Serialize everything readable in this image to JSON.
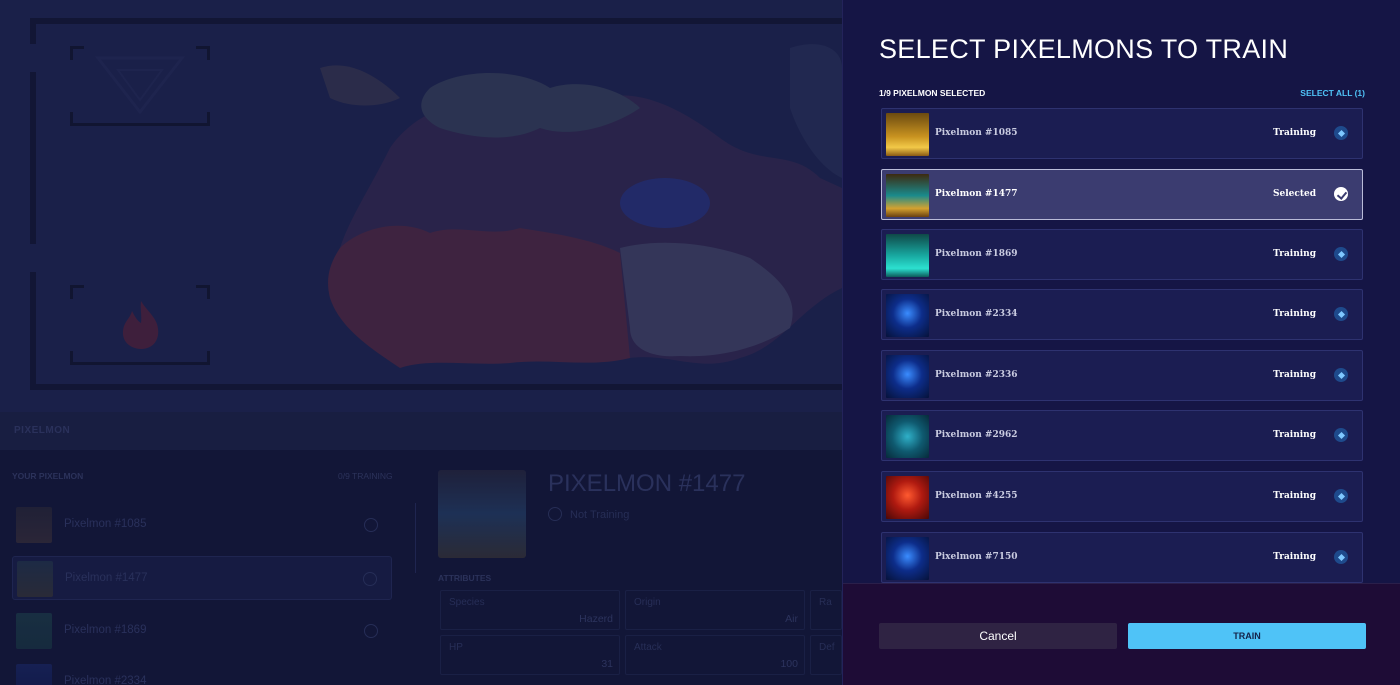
{
  "background": {
    "brand": "PIXELMON",
    "list_title": "YOUR PIXELMON",
    "list_count": "0/9 TRAINING",
    "list_items": [
      {
        "label": "Pixelmon #1085"
      },
      {
        "label": "Pixelmon #1477"
      },
      {
        "label": "Pixelmon #1869"
      },
      {
        "label": "Pixelmon #2334"
      }
    ],
    "detail": {
      "title": "PIXELMON #1477",
      "status": "Not Training",
      "attributes_title": "ATTRIBUTES",
      "attributes": [
        {
          "name": "Species",
          "value": "Hazerd"
        },
        {
          "name": "Origin",
          "value": "Air"
        },
        {
          "name": "Ra",
          "value": ""
        },
        {
          "name": "HP",
          "value": "31"
        },
        {
          "name": "Attack",
          "value": "100"
        },
        {
          "name": "Def",
          "value": ""
        }
      ]
    }
  },
  "modal": {
    "title": "SELECT PIXELMONS TO TRAIN",
    "selected_count": "1/9 PIXELMON SELECTED",
    "select_all": "SELECT ALL (1)",
    "pixelmons": [
      {
        "name": "Pixelmon #1085",
        "status": "Training",
        "icon": "plus-icon",
        "theme": "gold"
      },
      {
        "name": "Pixelmon #1477",
        "status": "Selected",
        "icon": "check-icon",
        "theme": "teal-gold"
      },
      {
        "name": "Pixelmon #1869",
        "status": "Training",
        "icon": "plus-icon",
        "theme": "teal"
      },
      {
        "name": "Pixelmon #2334",
        "status": "Training",
        "icon": "plus-icon",
        "theme": "blue"
      },
      {
        "name": "Pixelmon #2336",
        "status": "Training",
        "icon": "plus-icon",
        "theme": "blue"
      },
      {
        "name": "Pixelmon #2962",
        "status": "Training",
        "icon": "plus-icon",
        "theme": "cyan"
      },
      {
        "name": "Pixelmon #4255",
        "status": "Training",
        "icon": "plus-icon",
        "theme": "red"
      },
      {
        "name": "Pixelmon #7150",
        "status": "Training",
        "icon": "plus-icon",
        "theme": "blue"
      }
    ],
    "cancel_label": "Cancel",
    "train_label": "TRAIN"
  },
  "colors": {
    "accent": "#4fc3f7",
    "modal_bg": "#151545",
    "footer_bg": "#1e0c36"
  }
}
